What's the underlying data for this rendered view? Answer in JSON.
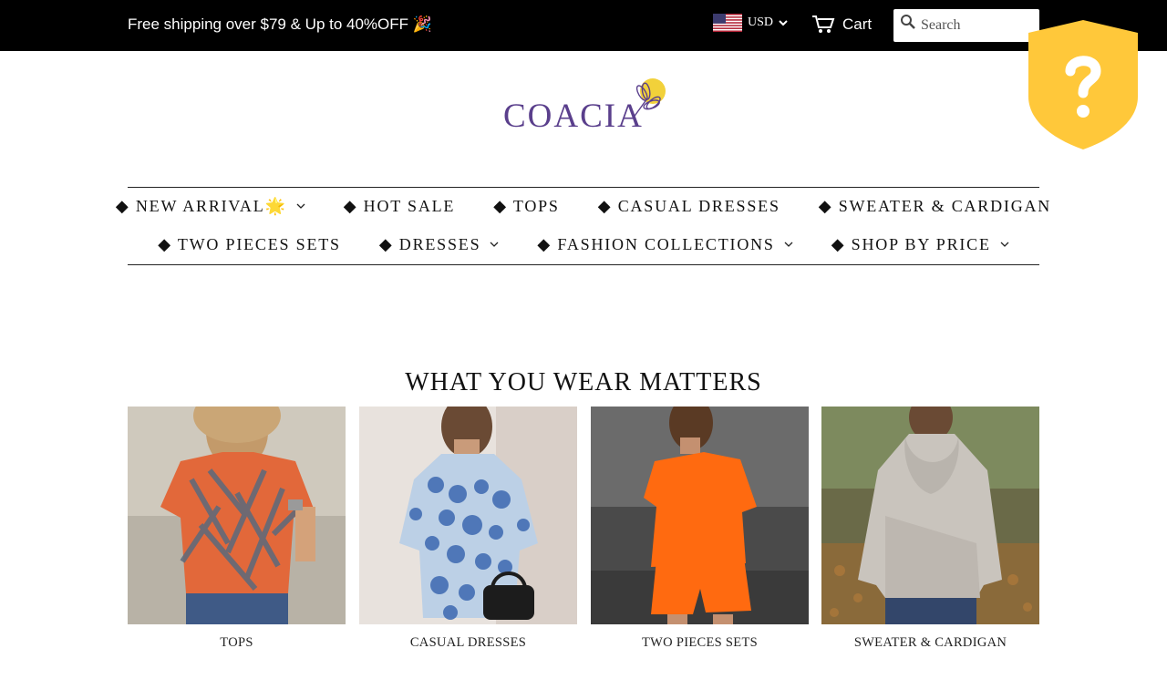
{
  "topbar": {
    "announcement": "Free shipping over $79 & Up to 40%OFF 🎉",
    "currency": {
      "code": "USD",
      "flag": "us-flag-icon"
    },
    "cart_label": "Cart",
    "search_placeholder": "Search",
    "search_value": ""
  },
  "shield_badge": {
    "icon": "question-shield-icon",
    "color": "#ffc83a"
  },
  "logo": {
    "text": "COACIA",
    "color": "#5a3f8c",
    "accent": "#f2d13a"
  },
  "nav": {
    "row1": [
      {
        "label": "◆ NEW ARRIVAL🌟",
        "has_dropdown": true
      },
      {
        "label": "◆ HOT SALE",
        "has_dropdown": false
      },
      {
        "label": "◆ TOPS",
        "has_dropdown": false
      },
      {
        "label": "◆ CASUAL DRESSES",
        "has_dropdown": false
      },
      {
        "label": "◆ SWEATER & CARDIGAN",
        "has_dropdown": false
      }
    ],
    "row2": [
      {
        "label": "◆ TWO PIECES SETS",
        "has_dropdown": false
      },
      {
        "label": "◆ DRESSES",
        "has_dropdown": true
      },
      {
        "label": "◆ FASHION COLLECTIONS",
        "has_dropdown": true
      },
      {
        "label": "◆ SHOP BY PRICE",
        "has_dropdown": true
      }
    ]
  },
  "main": {
    "title": "WHAT YOU WEAR MATTERS",
    "collections": [
      {
        "label": "TOPS",
        "image": "orange-leaf-print-tshirt-photo"
      },
      {
        "label": "CASUAL DRESSES",
        "image": "blue-dot-print-dress-photo"
      },
      {
        "label": "TWO PIECES SETS",
        "image": "orange-two-piece-set-photo"
      },
      {
        "label": "SWEATER & CARDIGAN",
        "image": "grey-cowl-neck-sweater-photo"
      }
    ]
  }
}
